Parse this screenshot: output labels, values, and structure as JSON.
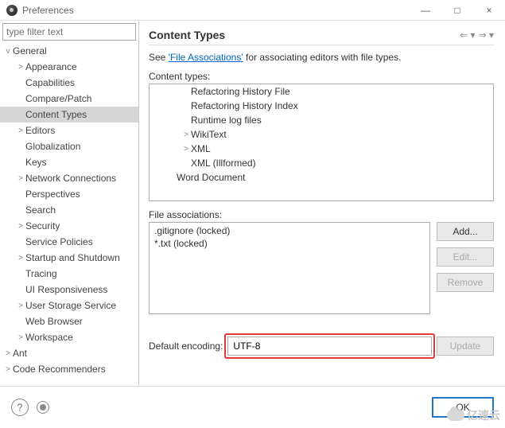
{
  "window": {
    "title": "Preferences",
    "min_icon": "—",
    "max_icon": "□",
    "close_icon": "×"
  },
  "filter": {
    "placeholder": "type filter text"
  },
  "tree": {
    "items": [
      {
        "label": "General",
        "depth": 0,
        "twisty": "v",
        "selected": false
      },
      {
        "label": "Appearance",
        "depth": 1,
        "twisty": ">",
        "selected": false
      },
      {
        "label": "Capabilities",
        "depth": 1,
        "twisty": "",
        "selected": false
      },
      {
        "label": "Compare/Patch",
        "depth": 1,
        "twisty": "",
        "selected": false
      },
      {
        "label": "Content Types",
        "depth": 1,
        "twisty": "",
        "selected": true
      },
      {
        "label": "Editors",
        "depth": 1,
        "twisty": ">",
        "selected": false
      },
      {
        "label": "Globalization",
        "depth": 1,
        "twisty": "",
        "selected": false
      },
      {
        "label": "Keys",
        "depth": 1,
        "twisty": "",
        "selected": false
      },
      {
        "label": "Network Connections",
        "depth": 1,
        "twisty": ">",
        "selected": false
      },
      {
        "label": "Perspectives",
        "depth": 1,
        "twisty": "",
        "selected": false
      },
      {
        "label": "Search",
        "depth": 1,
        "twisty": "",
        "selected": false
      },
      {
        "label": "Security",
        "depth": 1,
        "twisty": ">",
        "selected": false
      },
      {
        "label": "Service Policies",
        "depth": 1,
        "twisty": "",
        "selected": false
      },
      {
        "label": "Startup and Shutdown",
        "depth": 1,
        "twisty": ">",
        "selected": false
      },
      {
        "label": "Tracing",
        "depth": 1,
        "twisty": "",
        "selected": false
      },
      {
        "label": "UI Responsiveness",
        "depth": 1,
        "twisty": "",
        "selected": false
      },
      {
        "label": "User Storage Service",
        "depth": 1,
        "twisty": ">",
        "selected": false
      },
      {
        "label": "Web Browser",
        "depth": 1,
        "twisty": "",
        "selected": false
      },
      {
        "label": "Workspace",
        "depth": 1,
        "twisty": ">",
        "selected": false
      },
      {
        "label": "Ant",
        "depth": 0,
        "twisty": ">",
        "selected": false
      },
      {
        "label": "Code Recommenders",
        "depth": 0,
        "twisty": ">",
        "selected": false
      }
    ]
  },
  "section": {
    "title": "Content Types",
    "back": "⇐ ▾",
    "fwd": "⇒ ▾",
    "desc_prefix": "See ",
    "desc_link": "'File Associations'",
    "desc_suffix": " for associating editors with file types.",
    "content_types_label": "Content types:",
    "ct_items": [
      {
        "label": "Refactoring History File",
        "depth": 2,
        "twisty": ""
      },
      {
        "label": "Refactoring History Index",
        "depth": 2,
        "twisty": ""
      },
      {
        "label": "Runtime log files",
        "depth": 2,
        "twisty": ""
      },
      {
        "label": "WikiText",
        "depth": 2,
        "twisty": ">"
      },
      {
        "label": "XML",
        "depth": 2,
        "twisty": ">"
      },
      {
        "label": "XML (Illformed)",
        "depth": 2,
        "twisty": ""
      },
      {
        "label": "Word Document",
        "depth": 1,
        "twisty": ""
      }
    ],
    "file_assoc_label": "File associations:",
    "fa_items": [
      ".gitignore (locked)",
      "*.txt (locked)"
    ],
    "add_btn": "Add...",
    "edit_btn": "Edit...",
    "remove_btn": "Remove",
    "default_encoding_label": "Default encoding:",
    "default_encoding_value": "UTF-8",
    "update_btn": "Update"
  },
  "bottom": {
    "ok": "OK",
    "help": "?"
  },
  "watermark": "亿速云"
}
